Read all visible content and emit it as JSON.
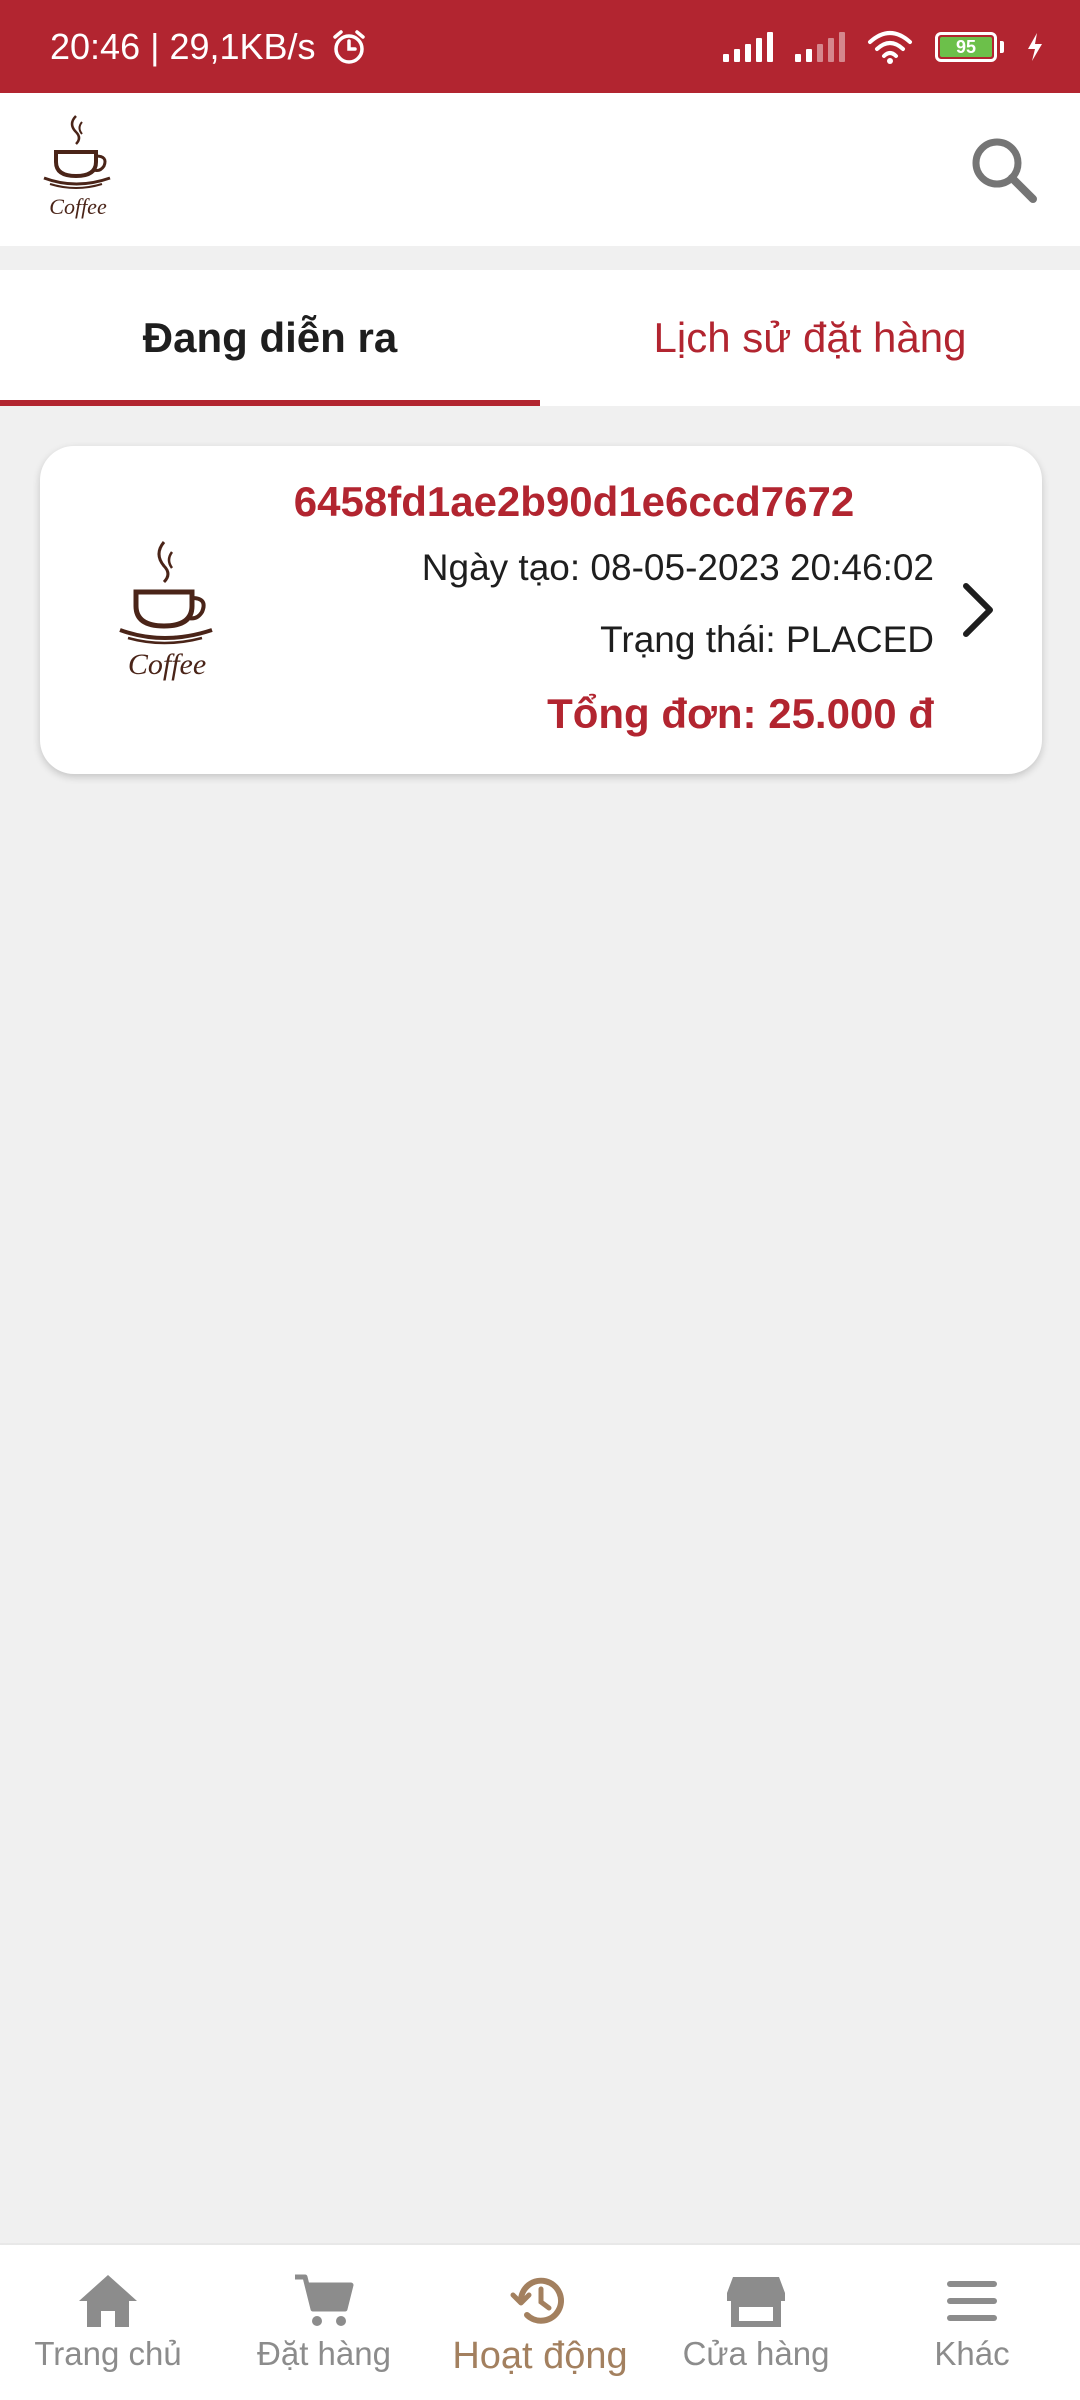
{
  "status_bar": {
    "time_speed": "20:46 | 29,1KB/s",
    "battery_level": "95",
    "icons": [
      "alarm-icon",
      "signal-icon",
      "signal-icon",
      "wifi-icon",
      "battery-icon",
      "charging-icon"
    ]
  },
  "header": {
    "logo_text": "Coffee",
    "search_icon": "search-icon"
  },
  "tabs": [
    {
      "label": "Đang diễn ra",
      "active": true
    },
    {
      "label": "Lịch sử đặt hàng",
      "active": false
    }
  ],
  "orders": [
    {
      "id": "6458fd1ae2b90d1e6ccd7672",
      "created": "Ngày tạo: 08-05-2023 20:46:02",
      "status": "Trạng thái: PLACED",
      "total": "Tổng đơn: 25.000 đ"
    }
  ],
  "bottom_nav": [
    {
      "label": "Trang chủ",
      "icon": "home-icon",
      "active": false
    },
    {
      "label": "Đặt hàng",
      "icon": "cart-icon",
      "active": false
    },
    {
      "label": "Hoạt động",
      "icon": "history-icon",
      "active": true
    },
    {
      "label": "Cửa hàng",
      "icon": "store-icon",
      "active": false
    },
    {
      "label": "Khác",
      "icon": "menu-icon",
      "active": false
    }
  ],
  "colors": {
    "brand": "#b22530",
    "active_nav": "#a3805f",
    "inactive_nav": "#8c8c8c",
    "background": "#f0f0f0"
  }
}
